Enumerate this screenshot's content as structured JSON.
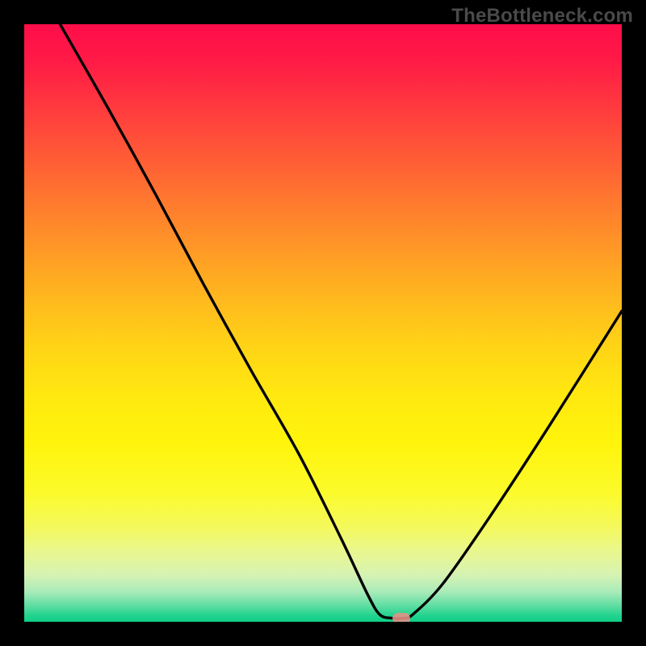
{
  "watermark": "TheBottleneck.com",
  "chart_data": {
    "type": "line",
    "title": "",
    "xlabel": "",
    "ylabel": "",
    "xlim": [
      0,
      100
    ],
    "ylim": [
      0,
      100
    ],
    "series": [
      {
        "name": "bottleneck-curve",
        "x": [
          6,
          14,
          22,
          30,
          38,
          46,
          53,
          57.5,
          59.5,
          61.5,
          63.5,
          65,
          70,
          78,
          88,
          100
        ],
        "values": [
          100,
          86,
          71.5,
          56.5,
          42,
          28,
          14,
          4.5,
          1.2,
          0.6,
          0.6,
          1.2,
          6.3,
          17.7,
          33,
          52
        ]
      }
    ],
    "marker": {
      "x": 63.1,
      "y": 0.6
    },
    "background_gradient": {
      "top": "#ff0d4a",
      "mid": "#ffe810",
      "bottom": "#0fce87"
    }
  }
}
